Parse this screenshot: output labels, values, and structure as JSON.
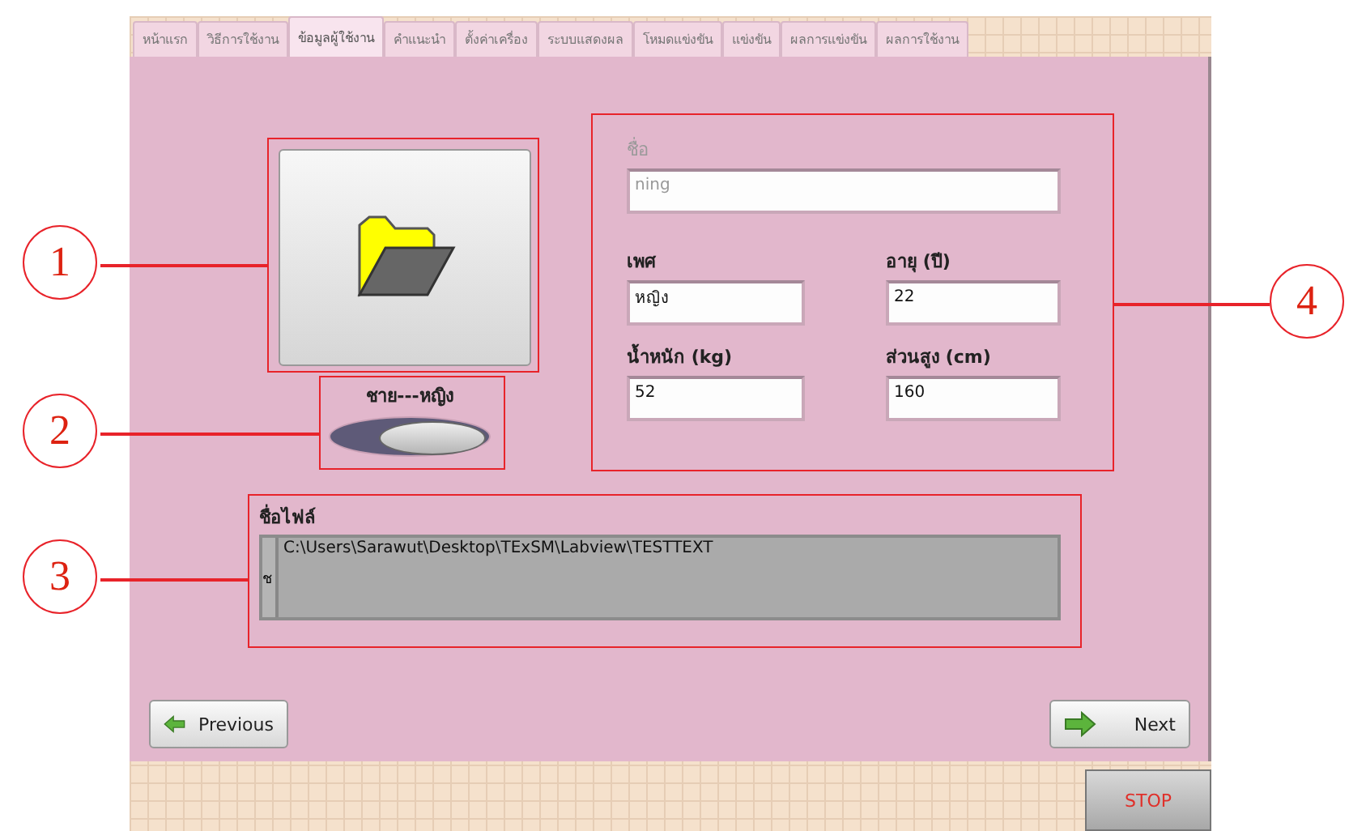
{
  "tabs": [
    {
      "label": "หน้าแรก",
      "selected": false
    },
    {
      "label": "วิธีการใช้งาน",
      "selected": false
    },
    {
      "label": "ข้อมูลผู้ใช้งาน",
      "selected": true
    },
    {
      "label": "คำแนะนำ",
      "selected": false
    },
    {
      "label": "ตั้งค่าเครื่อง",
      "selected": false
    },
    {
      "label": "ระบบแสดงผล",
      "selected": false
    },
    {
      "label": "โหมดแข่งขัน",
      "selected": false
    },
    {
      "label": "แข่งขัน",
      "selected": false
    },
    {
      "label": "ผลการแข่งขัน",
      "selected": false
    },
    {
      "label": "ผลการใช้งาน",
      "selected": false
    }
  ],
  "gender_switch": {
    "label": "ชาย---หญิง",
    "on": true
  },
  "user_fields": [
    {
      "kind": "wide",
      "label": "ชื่อ",
      "value": "ning"
    },
    {
      "kind": "half",
      "label": "เพศ",
      "value": "หญิง"
    },
    {
      "kind": "half",
      "label": "อายุ (ปี)",
      "value": "22"
    },
    {
      "kind": "half",
      "label": "น้ำหนัก (kg)",
      "value": "52"
    },
    {
      "kind": "half",
      "label": "ส่วนสูง (cm)",
      "value": "160"
    }
  ],
  "file_name": {
    "label": "ชื่อไฟล์",
    "prefix": "ช",
    "value": "C:\\Users\\Sarawut\\Desktop\\TExSM\\Labview\\TESTTEXT"
  },
  "previous_button": "Previous",
  "next_button": "Next",
  "stop_button": "STOP",
  "callouts": [
    {
      "number": "1"
    },
    {
      "number": "2"
    },
    {
      "number": "3"
    },
    {
      "number": "4"
    }
  ]
}
